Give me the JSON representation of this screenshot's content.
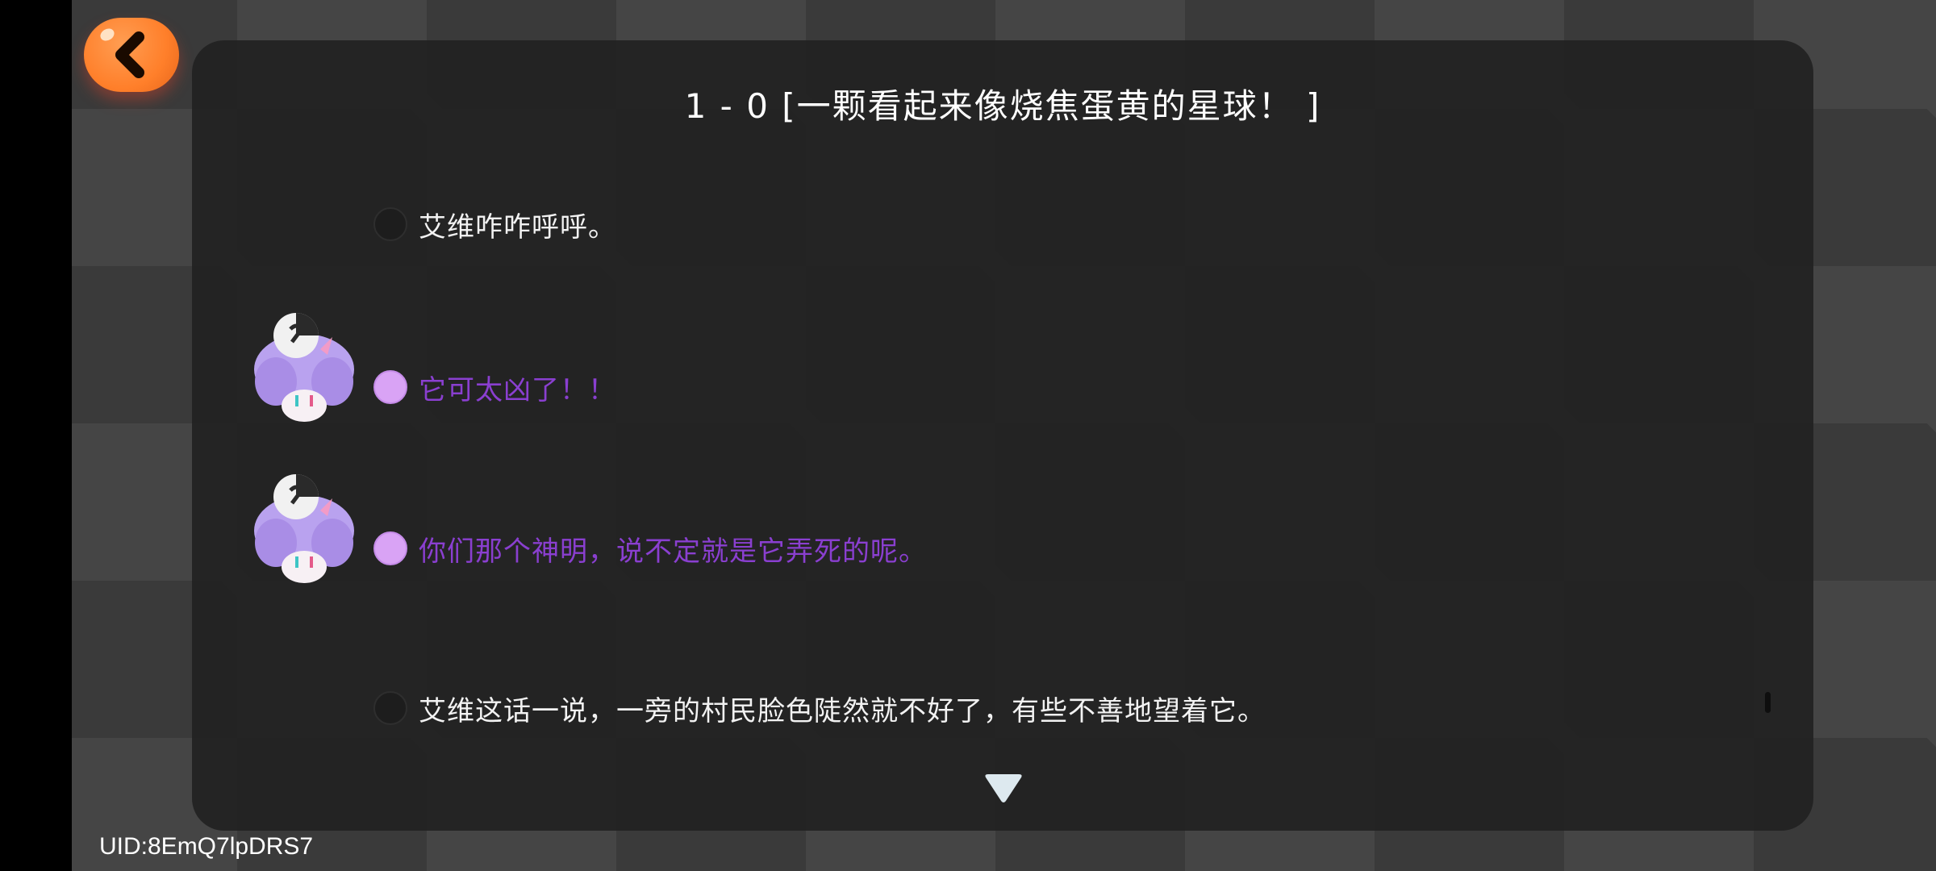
{
  "navigation": {
    "back_icon": "chevron-left-icon"
  },
  "dialog": {
    "title": "1 - 0 [一颗看起来像烧焦蛋黄的星球！ ]",
    "lines": [
      {
        "speaker": "narrator",
        "text": "艾维咋咋呼呼。",
        "color": "#f2f2f2"
      },
      {
        "speaker": "purple-character",
        "text": "它可太凶了！！",
        "color": "#8a3fd0"
      },
      {
        "speaker": "purple-character",
        "text": "你们那个神明，说不定就是它弄死的呢。",
        "color": "#8a3fd0"
      },
      {
        "speaker": "narrator",
        "text": "艾维这话一说，一旁的村民脸色陡然就不好了，有些不善地望着它。",
        "color": "#f2f2f2"
      }
    ],
    "next_icon": "triangle-down-icon"
  },
  "footer": {
    "uid": "UID:8EmQ7lpDRS7"
  },
  "colors": {
    "back_button": "#ff7f2a",
    "panel": "#222222",
    "speaker_purple": "#d9a3f5",
    "purple_text": "#8a3fd0"
  }
}
